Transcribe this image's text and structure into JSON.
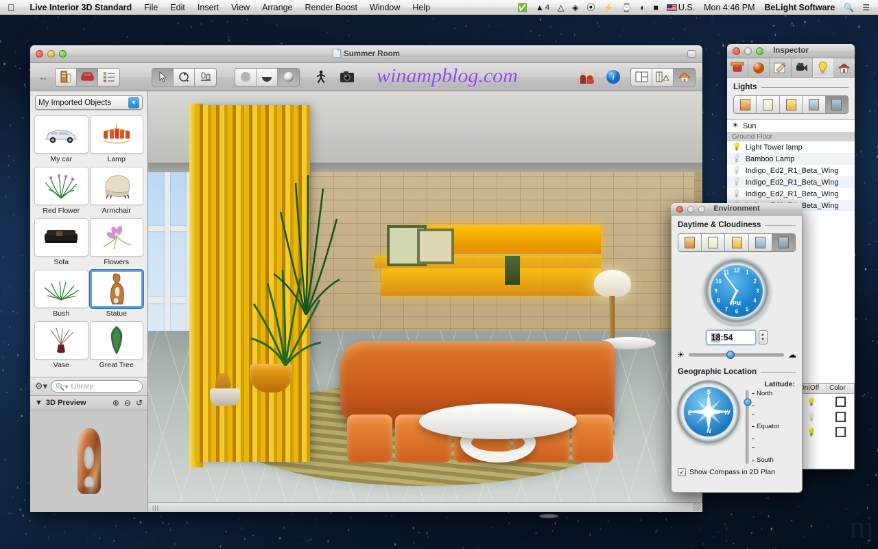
{
  "menubar": {
    "apple": "&#63743;",
    "app_name": "Live Interior 3D Standard",
    "items": [
      "File",
      "Edit",
      "Insert",
      "View",
      "Arrange",
      "Render Boost",
      "Window",
      "Help"
    ],
    "status_icons": [
      "check-circle-icon",
      "adobe-icon",
      "google-drive-icon",
      "dropbox-icon",
      "evernote-icon",
      "flash-icon",
      "time-machine-icon",
      "wifi-icon",
      "battery-icon"
    ],
    "adobe_count": "4",
    "input_source": "U.S.",
    "clock": "Mon 4:46 PM",
    "user": "BeLight Software",
    "spotlight": "search-icon",
    "notification": "notification-center-icon"
  },
  "main_window": {
    "title": "Summer Room",
    "watermark": "winampblog.com",
    "toolbar": {
      "left_group": [
        "building-icon",
        "furniture-icon",
        "list-icon"
      ],
      "tool_group": [
        "arrow-select-icon",
        "rotate-icon",
        "scale-icon"
      ],
      "render_group": [
        "flat-shading-icon",
        "shaded-icon",
        "glossy-render-icon"
      ],
      "walk_icon": "walkthrough-icon",
      "camera_icon": "camera-icon",
      "people_icon": "people-icon",
      "info_icon": "info-icon",
      "view_group": [
        "2d-plan-icon",
        "split-view-icon",
        "3d-view-icon"
      ]
    }
  },
  "sidebar": {
    "popup_label": "My Imported Objects",
    "objects": [
      {
        "label": "My car",
        "icon": "car-icon",
        "glyph": "🚘",
        "selected": false
      },
      {
        "label": "Lamp",
        "icon": "chandelier-icon",
        "glyph": "🕯",
        "selected": false
      },
      {
        "label": "Red Flower",
        "icon": "grass-icon",
        "glyph": "🌾",
        "selected": false
      },
      {
        "label": "Armchair",
        "icon": "armchair-icon",
        "glyph": "🛋",
        "selected": false
      },
      {
        "label": "Sofa",
        "icon": "sofa-icon",
        "glyph": "🛋",
        "selected": false
      },
      {
        "label": "Flowers",
        "icon": "flower-icon",
        "glyph": "🌺",
        "selected": false
      },
      {
        "label": "Bush",
        "icon": "bush-icon",
        "glyph": "🌿",
        "selected": false
      },
      {
        "label": "Statue",
        "icon": "statue-icon",
        "glyph": "🗿",
        "selected": true
      },
      {
        "label": "Vase",
        "icon": "vase-icon",
        "glyph": "🏺",
        "selected": false
      },
      {
        "label": "Great Tree",
        "icon": "tree-icon",
        "glyph": "🌲",
        "selected": false
      }
    ],
    "gear_icon": "gear-icon",
    "search_placeholder": "Library",
    "preview_title": "3D Preview",
    "preview_tools": [
      "zoom-in-icon",
      "zoom-out-icon",
      "rotate-icon"
    ]
  },
  "inspector": {
    "title": "Inspector",
    "tabs": [
      "object-icon",
      "material-icon",
      "edit-icon",
      "camera-icon",
      "light-icon",
      "building-icon"
    ],
    "active_tab_index": 4,
    "section_title": "Lights",
    "light_presets": [
      "morning-window-icon",
      "daylight-window-icon",
      "sunset-window-icon",
      "night-window-icon",
      "custom-time-window-icon"
    ],
    "active_preset_index": 4,
    "lights": [
      {
        "name": "Sun",
        "icon": "sun-icon",
        "group": false,
        "on": true
      },
      {
        "name": "Ground Floor",
        "icon": "",
        "group": true,
        "on": false
      },
      {
        "name": "Light Tower lamp",
        "icon": "bulb-on-icon",
        "group": false,
        "on": true
      },
      {
        "name": "Bamboo Lamp",
        "icon": "bulb-off-icon",
        "group": false,
        "on": false
      },
      {
        "name": "Indigo_Ed2_R1_Beta_Wing",
        "icon": "bulb-off-icon",
        "group": false,
        "on": false
      },
      {
        "name": "Indigo_Ed2_R1_Beta_Wing",
        "icon": "bulb-off-icon",
        "group": false,
        "on": false
      },
      {
        "name": "Indigo_Ed2_R1_Beta_Wing",
        "icon": "bulb-off-icon",
        "group": false,
        "on": false
      },
      {
        "name": "Indigo_Ed2_R1_Beta_Wing",
        "icon": "bulb-off-icon",
        "group": false,
        "on": false
      }
    ],
    "table": {
      "columns": [
        "On|Off",
        "Color"
      ],
      "rows": [
        {
          "on": true,
          "bulb_icon": "bulb-on-icon",
          "color": "#ffffff"
        },
        {
          "on": false,
          "bulb_icon": "bulb-off-icon",
          "color": "#ffffff"
        },
        {
          "on": true,
          "bulb_icon": "bulb-on-icon",
          "color": "#ffffff"
        }
      ]
    }
  },
  "environment": {
    "title": "Environment",
    "daytime_section": "Daytime & Cloudiness",
    "presets": [
      "morning-window-icon",
      "daylight-window-icon",
      "sunset-window-icon",
      "night-window-icon",
      "custom-time-window-icon"
    ],
    "active_preset_index": 4,
    "clock": {
      "numbers": [
        "12",
        "1",
        "2",
        "3",
        "4",
        "5",
        "6",
        "7",
        "8",
        "9",
        "10",
        "11"
      ],
      "meridiem": "PM",
      "hour_angle": 205,
      "minute_angle": 324
    },
    "time_value": "18:54",
    "time_selected_part": "18",
    "cloudiness_slider": {
      "min_icon": "sun-icon",
      "max_icon": "cloud-icon",
      "value_pct": 44
    },
    "geo_section": "Geographic Location",
    "compass": {
      "directions": [
        "N",
        "E",
        "S",
        "W"
      ]
    },
    "latitude_label": "Latitude:",
    "latitude_ticks": [
      "North",
      "",
      "",
      "Equator",
      "",
      "",
      "South"
    ],
    "latitude_value_pct": 17,
    "checkbox": {
      "label": "Show Compass in 2D Plan",
      "checked": true,
      "mark": "✓"
    }
  },
  "colors": {
    "accent_blue": "#2b7fce",
    "watermark_purple": "#8a3ff0",
    "curtain_gold": "#e8b700",
    "sofa_orange": "#d8661f",
    "desktop_dark": "#0d1d35"
  }
}
